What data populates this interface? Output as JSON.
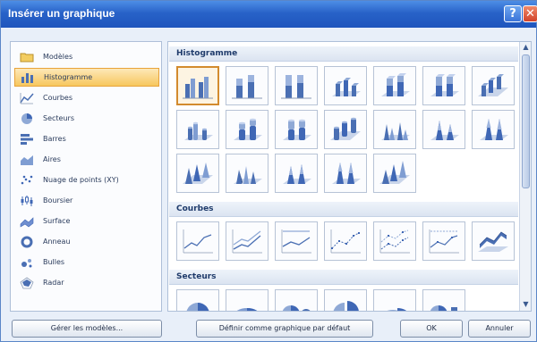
{
  "window": {
    "title": "Insérer un graphique"
  },
  "sidebar": {
    "items": [
      {
        "label": "Modèles",
        "icon": "folder-icon"
      },
      {
        "label": "Histogramme",
        "icon": "column-chart-icon",
        "selected": true
      },
      {
        "label": "Courbes",
        "icon": "line-chart-icon"
      },
      {
        "label": "Secteurs",
        "icon": "pie-chart-icon"
      },
      {
        "label": "Barres",
        "icon": "bar-chart-icon"
      },
      {
        "label": "Aires",
        "icon": "area-chart-icon"
      },
      {
        "label": "Nuage de points (XY)",
        "icon": "scatter-chart-icon"
      },
      {
        "label": "Boursier",
        "icon": "stock-chart-icon"
      },
      {
        "label": "Surface",
        "icon": "surface-chart-icon"
      },
      {
        "label": "Anneau",
        "icon": "doughnut-chart-icon"
      },
      {
        "label": "Bulles",
        "icon": "bubble-chart-icon"
      },
      {
        "label": "Radar",
        "icon": "radar-chart-icon"
      }
    ]
  },
  "gallery": {
    "groups": [
      {
        "title": "Histogramme"
      },
      {
        "title": "Courbes"
      },
      {
        "title": "Secteurs"
      }
    ]
  },
  "buttons": {
    "manage_templates": "Gérer les modèles...",
    "set_default": "Définir comme graphique par défaut",
    "ok": "OK",
    "cancel": "Annuler"
  },
  "colors": {
    "accent": "#3f67b5",
    "selection": "#f7c75e",
    "title_bar": "#2862c8"
  }
}
